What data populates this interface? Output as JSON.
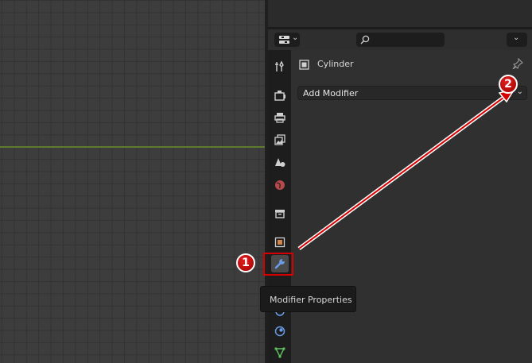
{
  "properties_editor": {
    "object_name": "Cylinder",
    "add_modifier_label": "Add Modifier",
    "tabs": [
      "tool",
      "render",
      "output",
      "view-layer",
      "scene",
      "world",
      "collection",
      "object",
      "modifier",
      "particles",
      "physics",
      "constraints",
      "data"
    ],
    "active_tab": "modifier"
  },
  "tooltip": {
    "text": "Modifier Properties"
  },
  "callouts": {
    "step1": "1",
    "step2": "2"
  },
  "colors": {
    "callout_red": "#d60000",
    "axis_line": "#5e7a2e",
    "modifier_icon": "#6a9ce8",
    "object_icon": "#d2844c",
    "data_icon": "#5fbf5f"
  }
}
